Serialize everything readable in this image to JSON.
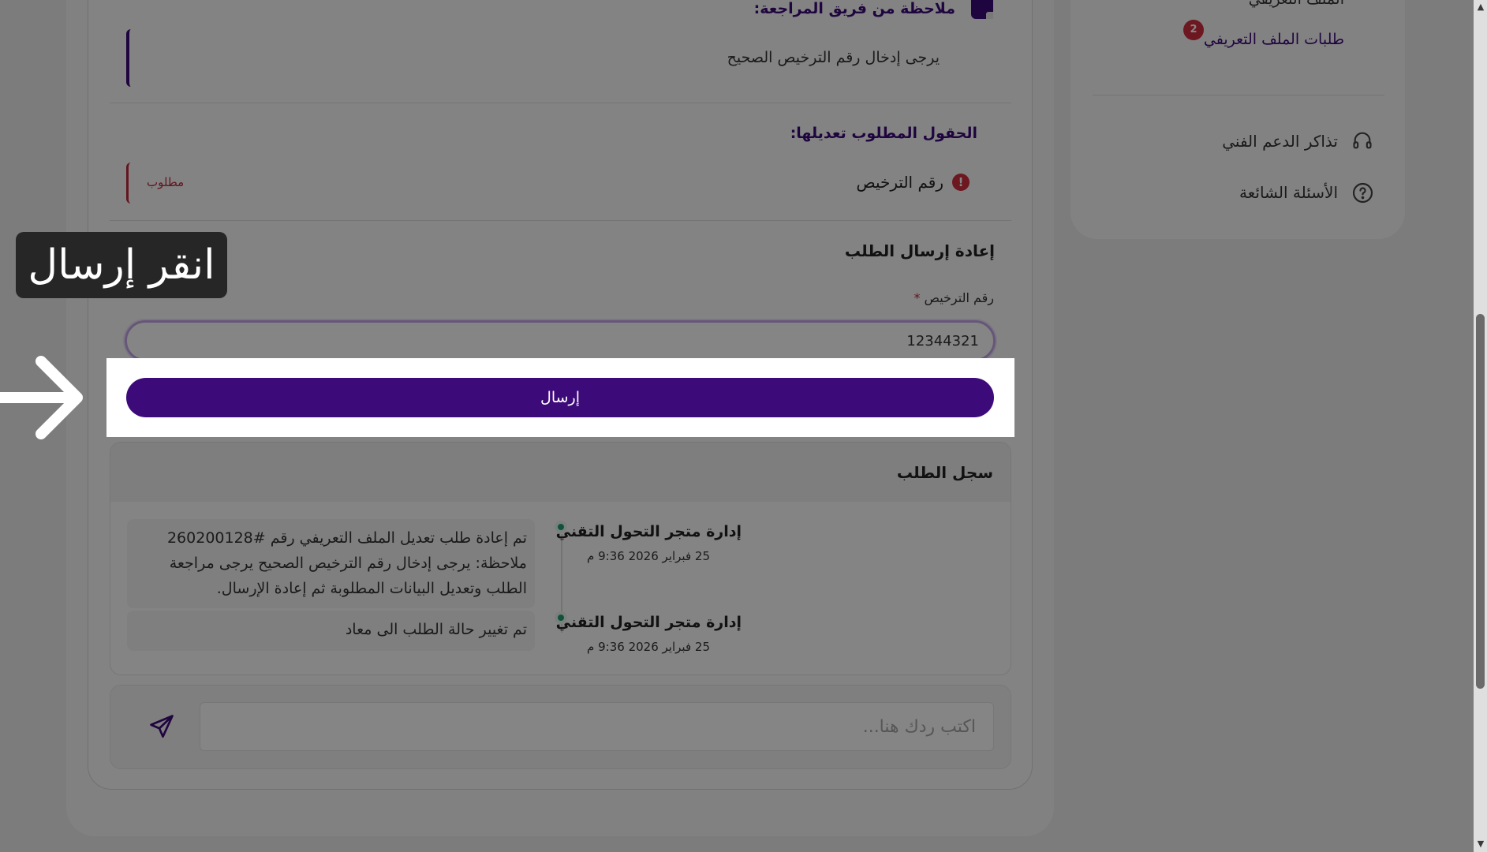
{
  "review_note": {
    "title": "ملاحظة من فريق المراجعة:",
    "text": "يرجى إدخال رقم الترخيص الصحيح"
  },
  "fields_to_edit": {
    "title": "الحقول المطلوب تعديلها:",
    "field_name": "رقم الترخيص",
    "required_label": "مطلوب"
  },
  "resubmit": {
    "title": "إعادة إرسال الطلب",
    "license_label": "رقم الترخيص",
    "required_star": "*",
    "license_value": "12344321",
    "submit_label": "إرسال"
  },
  "history": {
    "title": "سجل الطلب",
    "entries": [
      {
        "author": "إدارة متجر التحول التقني",
        "time": "25 فبراير 2026 9:36 م",
        "message": "تم إعادة طلب تعديل الملف التعريفي رقم #260200128 ملاحظة: يرجى إدخال رقم الترخيص الصحيح يرجى مراجعة الطلب وتعديل البيانات المطلوبة ثم إعادة الإرسال."
      },
      {
        "author": "إدارة متجر التحول التقني",
        "time": "25 فبراير 2026 9:36 م",
        "message": "تم تغيير حالة الطلب الى معاد"
      }
    ]
  },
  "reply": {
    "placeholder": "اكتب ردك هنا..."
  },
  "sidebar": {
    "items": [
      {
        "label": "الملف التعريفي",
        "dot_color": "#9a9a9a"
      },
      {
        "label": "طلبات الملف التعريفي",
        "dot_color": "#5b2d8e",
        "badge": "2"
      }
    ],
    "links": [
      {
        "label": "تذاكر الدعم الفني",
        "icon": "headset-icon"
      },
      {
        "label": "الأسئلة الشائعة",
        "icon": "question-circle-icon"
      }
    ]
  },
  "tutorial": {
    "tooltip": "انقر إرسال"
  },
  "colors": {
    "primary": "#3d0a7a",
    "danger": "#d22c3e",
    "success": "#1f9e6d"
  }
}
